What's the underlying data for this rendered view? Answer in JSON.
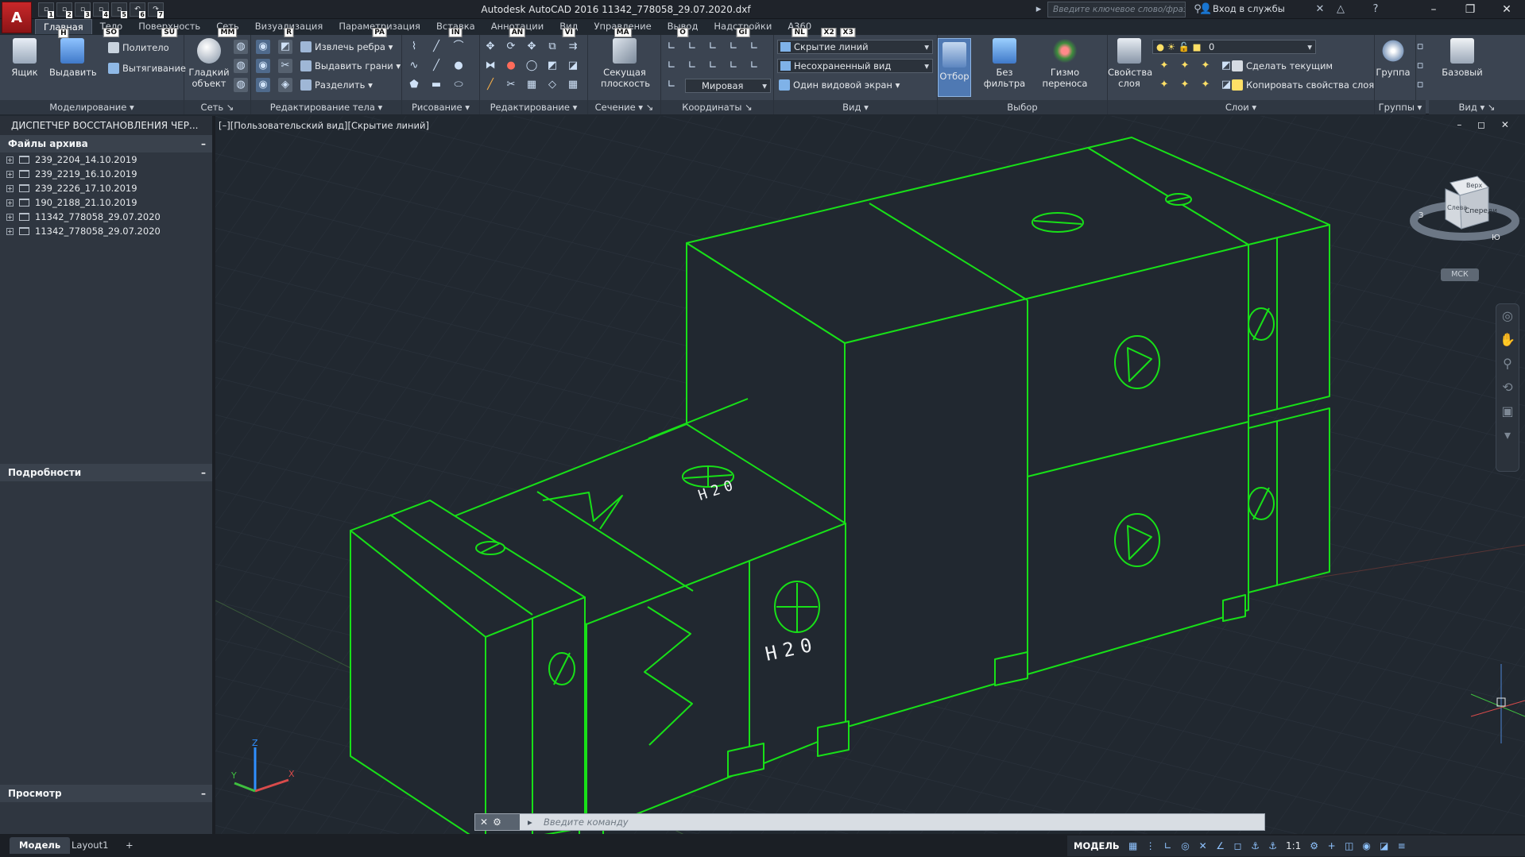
{
  "app": {
    "logo_letter": "A",
    "window_title": "Autodesk AutoCAD 2016    11342_778058_29.07.2020.dxf",
    "search_placeholder": "Введите ключевое слово/фразу",
    "sign_in": "Вход в службы",
    "quick_access": [
      {
        "key": "1"
      },
      {
        "key": "2"
      },
      {
        "key": "3"
      },
      {
        "key": "4"
      },
      {
        "key": "5"
      },
      {
        "key": "6"
      },
      {
        "key": "7"
      }
    ]
  },
  "ribbon_tabs": [
    {
      "label": "Главная",
      "keytip": "H",
      "active": true
    },
    {
      "label": "Тело",
      "keytip": "SO"
    },
    {
      "label": "Поверхность",
      "keytip": "SU"
    },
    {
      "label": "Сеть",
      "keytip": "MM"
    },
    {
      "label": "Визуализация",
      "keytip": "R"
    },
    {
      "label": "Параметризация",
      "keytip": "PA"
    },
    {
      "label": "Вставка",
      "keytip": "IN"
    },
    {
      "label": "Аннотации",
      "keytip": "AN"
    },
    {
      "label": "Вид",
      "keytip": "VI"
    },
    {
      "label": "Управление",
      "keytip": "MA"
    },
    {
      "label": "Вывод",
      "keytip": "O"
    },
    {
      "label": "Надстройки",
      "keytip": "GI"
    },
    {
      "label": "A360",
      "keytip": "NL"
    },
    {
      "label": "",
      "keytip": "X2"
    },
    {
      "label": "",
      "keytip": "X3"
    }
  ],
  "panels": {
    "modeling": {
      "title": "Моделирование",
      "box": "Ящик",
      "extrude": "Выдавить",
      "polysolid": "Политело",
      "presspull": "Вытягивание"
    },
    "mesh": {
      "title": "Сеть",
      "smooth": "Гладкий объект"
    },
    "solid_edit": {
      "title": "Редактирование тела",
      "extract_edges": "Извлечь ребра",
      "extrude_faces": "Выдавить грани",
      "separate": "Разделить"
    },
    "draw": {
      "title": "Рисование"
    },
    "modify": {
      "title": "Редактирование"
    },
    "section": {
      "title": "Сечение",
      "plane": "Секущая плоскость"
    },
    "coordinates": {
      "title": "Координаты",
      "ucs": "Мировая"
    },
    "view": {
      "title": "Вид",
      "visual_style": "Скрытие линий",
      "named_view": "Несохраненный вид",
      "viewports": "Один видовой экран"
    },
    "selection": {
      "title": "Выбор",
      "culling": "Отбор",
      "no_filter": "Без фильтра",
      "gizmo": "Гизмо переноса"
    },
    "layers": {
      "title": "Слои",
      "layer_props": "Свойства слоя",
      "current_layer": "0",
      "make_current": "Сделать текущим",
      "match_layer": "Копировать свойства слоя"
    },
    "groups": {
      "title": "Группы",
      "group": "Группа"
    },
    "view2": {
      "title": "Вид",
      "base": "Базовый"
    }
  },
  "palette": {
    "title": "ДИСПЕТЧЕР ВОССТАНОВЛЕНИЯ ЧЕР...",
    "archive_header": "Файлы архива",
    "files": [
      "239_2204_14.10.2019",
      "239_2219_16.10.2019",
      "239_2226_17.10.2019",
      "190_2188_21.10.2019",
      "11342_778058_29.07.2020",
      "11342_778058_29.07.2020"
    ],
    "details_header": "Подробности",
    "preview_header": "Просмотр",
    "collapse": "–"
  },
  "viewport": {
    "label": "[–][Пользовательский вид][Скрытие линий]",
    "controls": "– ◻ ✕",
    "viewcube": {
      "top": "Верх",
      "left": "Слева",
      "front": "Спереди",
      "compass_s": "Ю",
      "compass_w": "З"
    },
    "wcs_label": "МСК",
    "annotations": {
      "h2o_top": "H20",
      "h2o_front": "H20"
    },
    "accent_color": "#18e018"
  },
  "command_line": {
    "placeholder": "Введите команду"
  },
  "layout_tabs": [
    "Модель",
    "Layout1",
    "+"
  ],
  "status": {
    "model": "МОДЕЛЬ",
    "scale": "1:1"
  }
}
